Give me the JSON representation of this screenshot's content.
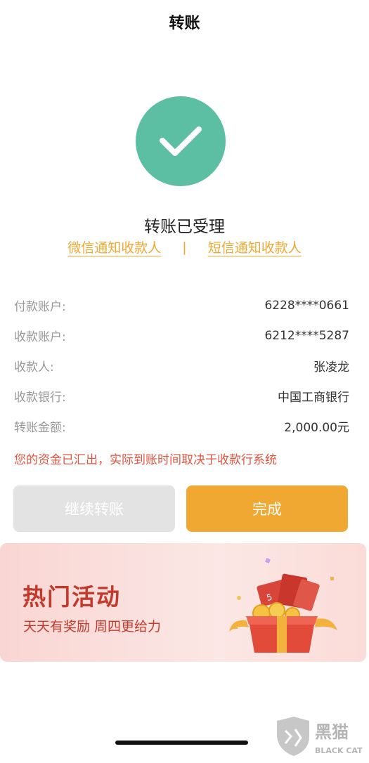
{
  "header": {
    "title": "转账"
  },
  "status": {
    "text": "转账已受理",
    "icon": "check-icon",
    "color": "#5cbfa4"
  },
  "notify": {
    "wechat_label": "微信通知收款人",
    "separator": "|",
    "sms_label": "短信通知收款人"
  },
  "info_rows": [
    {
      "label": "付款账户:",
      "value": "6228****0661"
    },
    {
      "label": "收款账户:",
      "value": "6212****5287"
    },
    {
      "label": "收款人:",
      "value": "张凌龙"
    },
    {
      "label": "收款银行:",
      "value": "中国工商银行"
    },
    {
      "label": "转账金额:",
      "value": "2,000.00元"
    }
  ],
  "notice": "您的资金已汇出，实际到账时间取决于收款行系统",
  "buttons": {
    "continue_label": "继续转账",
    "done_label": "完成"
  },
  "banner": {
    "title": "热门活动",
    "subtitle": "天天有奖励  周四更给力",
    "art_icon": "gift-box-icon",
    "ticket_text": "5"
  },
  "watermark": {
    "line1": "黑猫",
    "line2": "BLACK CAT"
  },
  "colors": {
    "accent": "#f0a832",
    "success": "#5cbfa4",
    "warning": "#e0533f",
    "banner_red": "#c23a2b"
  }
}
